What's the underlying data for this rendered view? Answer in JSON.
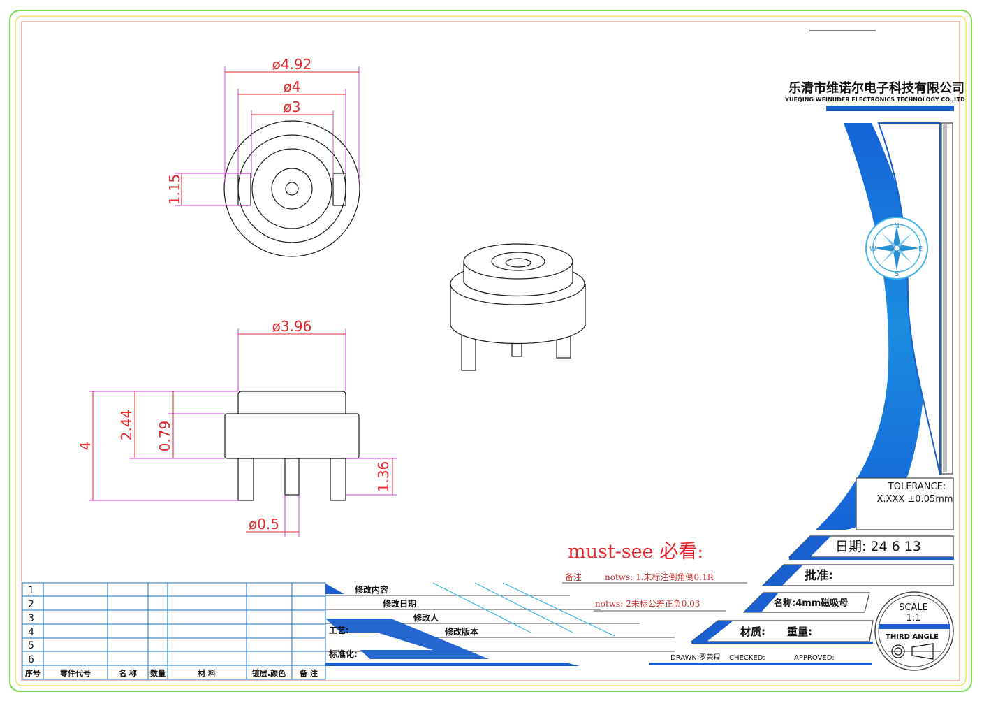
{
  "company": {
    "name_cn": "乐清市维诺尔电子科技有限公司",
    "name_en": "YUEQING WEINUDER ELECTRONICS TECHNOLOGY CO.,LTD"
  },
  "dimensions": {
    "d492": "ø4.92",
    "d4": "ø4",
    "d3": "ø3",
    "h115": "1.15",
    "d396": "ø3.96",
    "h4": "4",
    "h244": "2.44",
    "h079": "0.79",
    "h136": "1.36",
    "d05": "ø0.5"
  },
  "compass": {
    "n": "N",
    "e": "E",
    "s": "S",
    "w": "W"
  },
  "notes": {
    "must_see": "must-see 必看:",
    "remark_label": "备注",
    "note1": "notws: 1.未标注倒角倒0.1R",
    "note2": "notws: 2未标公差正负0.03"
  },
  "title_block": {
    "tolerance_label": "TOLERANCE:",
    "tolerance_value": "X.XXX ±0.05mm",
    "date": "日期: 24 6 13",
    "approve": "批准:",
    "name": "名称:4mm磁吸母",
    "material": "材质:",
    "weight": "重量:",
    "drawn": "DRAWN:罗荣程",
    "checked": "CHECKED:",
    "approved": "APPROVED:",
    "scale_label": "SCALE",
    "scale_value": "1:1",
    "third_angle": "THIRD ANGLE"
  },
  "revision": {
    "content": "修改内容",
    "date": "修改日期",
    "person": "修改人",
    "version": "修改版本",
    "process": "工艺:",
    "standard": "标准化:"
  },
  "bom": {
    "rows": [
      "1",
      "2",
      "3",
      "4",
      "5",
      "6"
    ],
    "headers": [
      "序号",
      "零件代号",
      "名 称",
      "数量",
      "材 料",
      "镀层.颜色",
      "备 注"
    ]
  },
  "colors": {
    "accent_blue": "#1a5fd0",
    "dim_red": "#e0262a",
    "dim_magenta": "#d23fd8",
    "frame_green": "#7ed957"
  }
}
